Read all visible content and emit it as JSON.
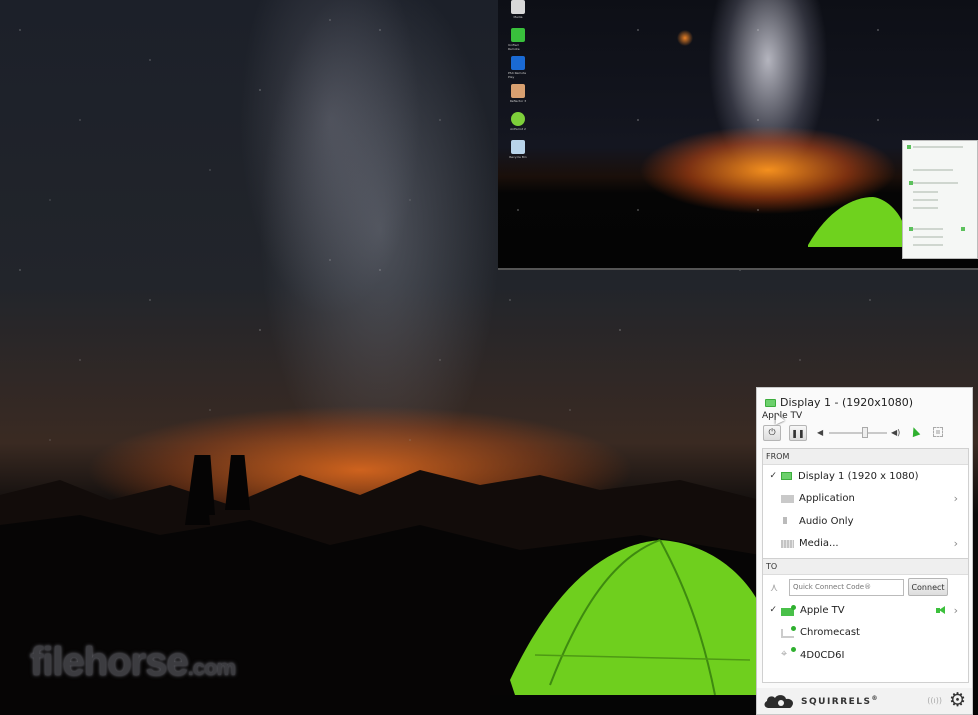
{
  "desktop": {
    "watermark": {
      "brand": "filehorse",
      "tld": ".com"
    },
    "remote_screen": {
      "desktop_icons": [
        {
          "name": "Media",
          "color": "#d8d8d8"
        },
        {
          "name": "Unified Remote",
          "color": "#39c03c"
        },
        {
          "name": "PS4 Remote Play",
          "color": "#1a6ad4"
        },
        {
          "name": "Reflector 3",
          "color": "#d9a070"
        },
        {
          "name": "AirParrot 2",
          "color": "#7dcf3a"
        },
        {
          "name": "Recycle Bin",
          "color": "#b9d4ea"
        }
      ]
    }
  },
  "panel": {
    "header": {
      "title": "Display 1 - (1920x1080)",
      "subtitle": "Apple TV"
    },
    "controls": {
      "power_icon": "⏻",
      "pause_icon": "❚❚",
      "volume_low_icon": "◀",
      "volume_high_icon": "◀)",
      "volume_level": 0.62
    },
    "from": {
      "title": "FROM",
      "items": [
        {
          "label": "Display 1 (1920 x 1080)",
          "checked": true,
          "icon": "display-icon",
          "submenu": false
        },
        {
          "label": "Application",
          "checked": false,
          "icon": "application-icon",
          "submenu": true
        },
        {
          "label": "Audio Only",
          "checked": false,
          "icon": "audio-icon",
          "submenu": false
        },
        {
          "label": "Media...",
          "checked": false,
          "icon": "media-icon",
          "submenu": true
        }
      ]
    },
    "to": {
      "title": "TO",
      "quick_connect_placeholder": "Quick Connect Code®",
      "quick_connect_value": "",
      "connect_label": "Connect",
      "devices": [
        {
          "label": "Apple TV",
          "checked": true,
          "icon": "apple-tv-icon",
          "audio": true,
          "submenu": true
        },
        {
          "label": "Chromecast",
          "checked": false,
          "icon": "chromecast-icon",
          "audio": false,
          "submenu": false
        },
        {
          "label": "4D0CD6I",
          "checked": false,
          "icon": "network-device-icon",
          "audio": false,
          "submenu": false
        }
      ]
    },
    "footer": {
      "brand": "SQUIRRELS",
      "brand_mark": "®",
      "wifi_icon": "((ı))",
      "gear_icon": "⚙"
    },
    "glyphs": {
      "check": "✓",
      "chevron": "›"
    },
    "accent_color": "#3cc03c"
  }
}
